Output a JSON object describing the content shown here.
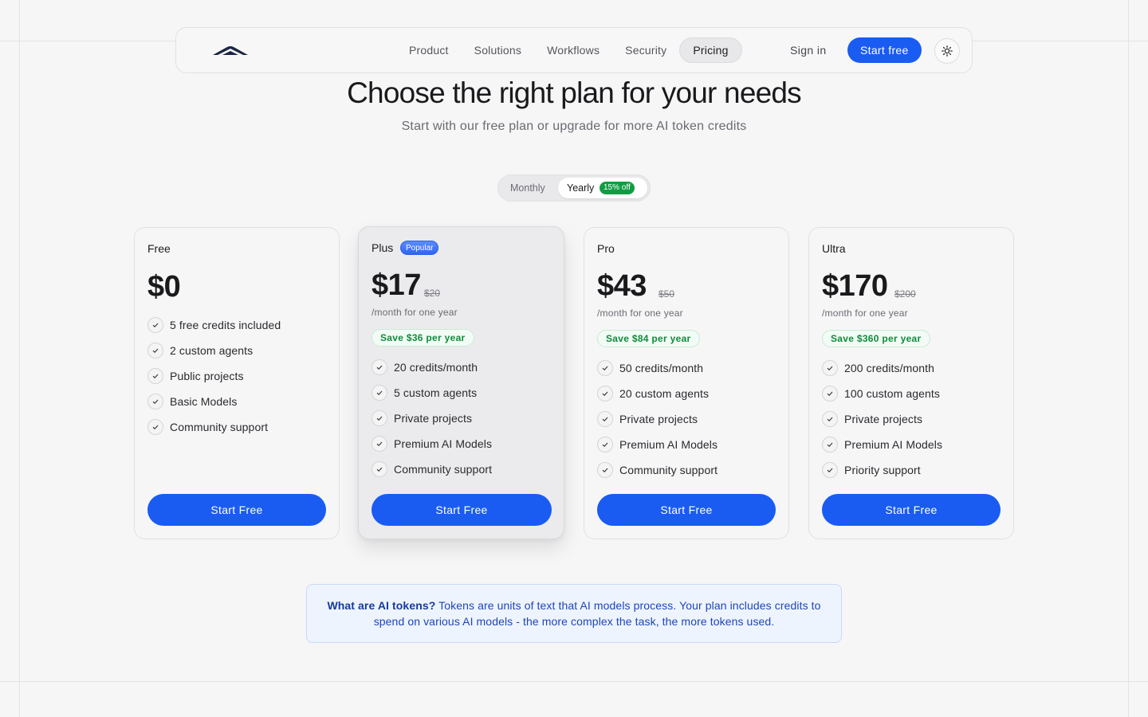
{
  "nav": {
    "links": [
      "Product",
      "Solutions",
      "Workflows",
      "Security",
      "Pricing"
    ],
    "active": "Pricing",
    "signin": "Sign in",
    "start": "Start free"
  },
  "header": {
    "title": "Choose the right plan for your needs",
    "subtitle": "Start with our free plan or upgrade for more AI token credits"
  },
  "billing": {
    "monthly": "Monthly",
    "yearly": "Yearly",
    "discount": "15% off",
    "selected": "Yearly"
  },
  "plans": [
    {
      "name": "Free",
      "price": "$0",
      "features": [
        "5 free credits included",
        "2 custom agents",
        "Public projects",
        "Basic Models",
        "Community support"
      ],
      "cta": "Start Free"
    },
    {
      "name": "Plus",
      "badge": "Popular",
      "price": "$17",
      "old_price": "$20",
      "period": "/month for one year",
      "save": "Save $36 per year",
      "features": [
        "20 credits/month",
        "5 custom agents",
        "Private projects",
        "Premium AI Models",
        "Community support"
      ],
      "cta": "Start Free"
    },
    {
      "name": "Pro",
      "price": "$43",
      "old_price": "$50",
      "period": "/month for one year",
      "save": "Save $84 per year",
      "features": [
        "50 credits/month",
        "20 custom agents",
        "Private projects",
        "Premium AI Models",
        "Community support"
      ],
      "cta": "Start Free"
    },
    {
      "name": "Ultra",
      "price": "$170",
      "old_price": "$200",
      "period": "/month for one year",
      "save": "Save $360 per year",
      "features": [
        "200 credits/month",
        "100 custom agents",
        "Private projects",
        "Premium AI Models",
        "Priority support"
      ],
      "cta": "Start Free"
    }
  ],
  "info": {
    "heading": "What are AI tokens?",
    "body": "Tokens are units of text that AI models process. Your plan includes credits to spend on various AI models - the more complex the task, the more tokens used."
  },
  "colors": {
    "accent": "#1a5cf2",
    "success": "#0f9d44",
    "info_text": "#1e45b8"
  }
}
